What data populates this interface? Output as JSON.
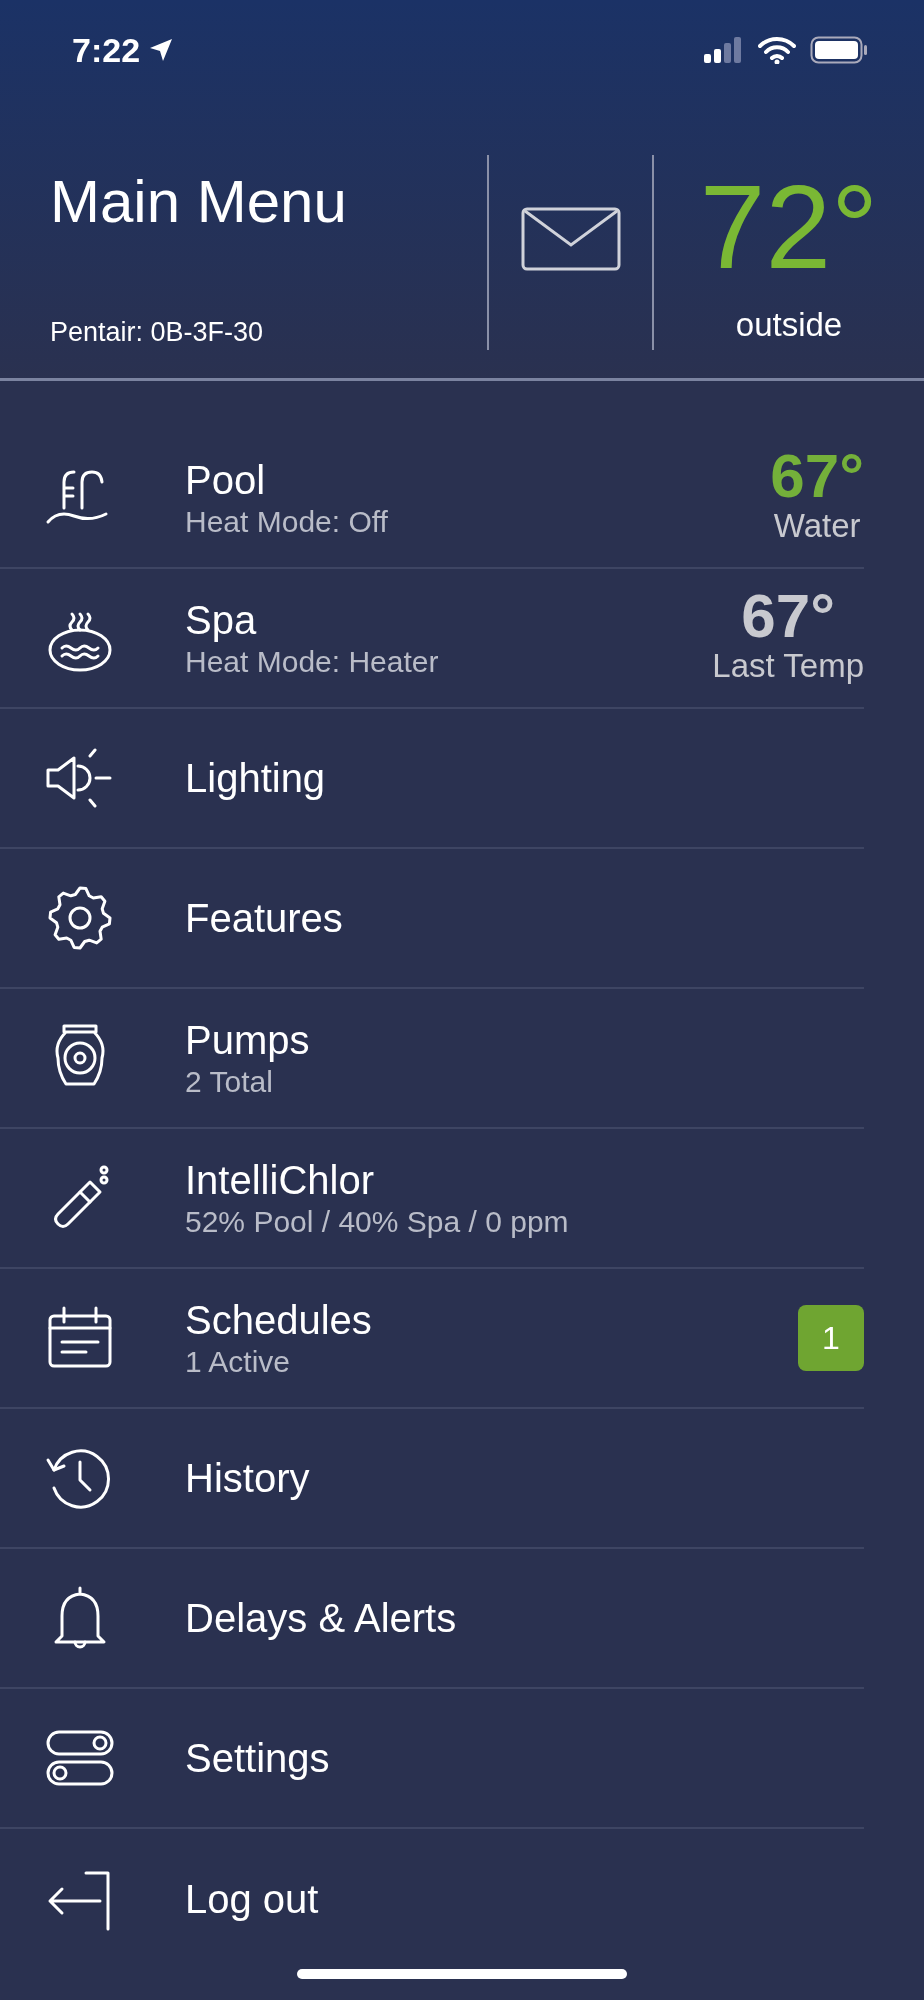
{
  "status_bar": {
    "time": "7:22"
  },
  "header": {
    "title": "Main Menu",
    "subtitle": "Pentair: 0B-3F-30",
    "outside_temp": "72°",
    "outside_label": "outside"
  },
  "menu": [
    {
      "title": "Pool",
      "subtitle": "Heat Mode: Off",
      "temp": {
        "value": "67°",
        "label": "Water",
        "color": "#74b03a"
      }
    },
    {
      "title": "Spa",
      "subtitle": "Heat Mode: Heater",
      "temp": {
        "value": "67°",
        "label": "Last Temp",
        "color": "#c8c9cf"
      }
    },
    {
      "title": "Lighting"
    },
    {
      "title": "Features"
    },
    {
      "title": "Pumps",
      "subtitle": "2 Total"
    },
    {
      "title": "IntelliChlor",
      "subtitle": "52% Pool / 40% Spa / 0 ppm"
    },
    {
      "title": "Schedules",
      "subtitle": "1 Active",
      "badge": "1"
    },
    {
      "title": "History"
    },
    {
      "title": "Delays & Alerts"
    },
    {
      "title": "Settings"
    },
    {
      "title": "Log out"
    }
  ]
}
